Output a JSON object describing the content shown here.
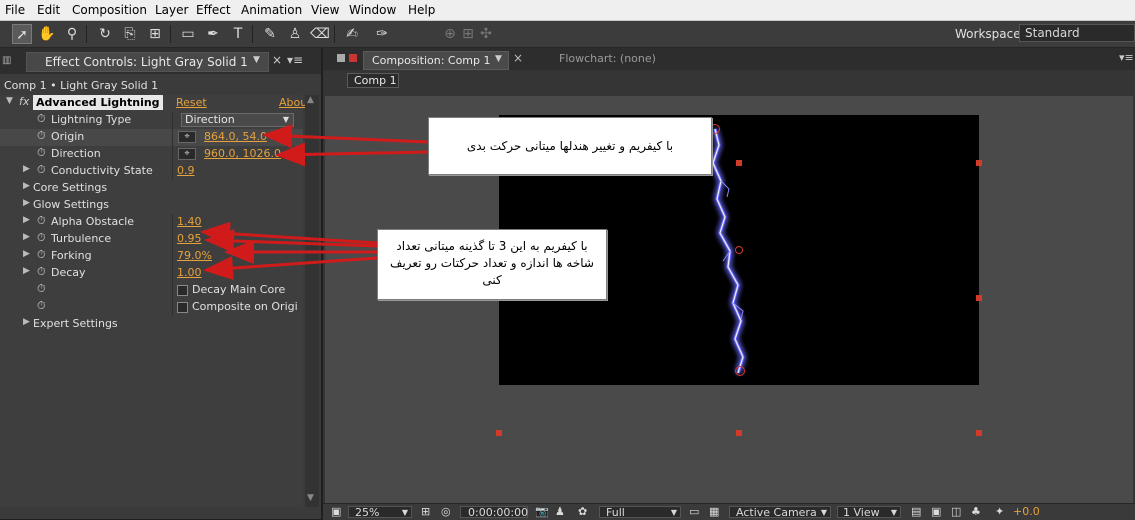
{
  "menu": [
    "File",
    "Edit",
    "Composition",
    "Layer",
    "Effect",
    "Animation",
    "View",
    "Window",
    "Help"
  ],
  "workspace": {
    "label": "Workspace:",
    "value": "Standard"
  },
  "effect_panel": {
    "tab_label": "Effect Controls: Light Gray Solid 1",
    "breadcrumb": "Comp 1 • Light Gray Solid 1",
    "effect_name": "Advanced Lightning",
    "reset": "Reset",
    "about": "Abou",
    "lightning_type": {
      "label": "Lightning Type",
      "value": "Direction"
    },
    "origin": {
      "label": "Origin",
      "value": "864.0, 54.0"
    },
    "direction": {
      "label": "Direction",
      "value": "960.0, 1026.0"
    },
    "conductivity": {
      "label": "Conductivity State",
      "value": "0.9"
    },
    "core_settings": "Core Settings",
    "glow_settings": "Glow Settings",
    "alpha_obstacle": {
      "label": "Alpha Obstacle",
      "value": "1.40"
    },
    "turbulence": {
      "label": "Turbulence",
      "value": "0.95"
    },
    "forking": {
      "label": "Forking",
      "value": "79.0%"
    },
    "decay": {
      "label": "Decay",
      "value": "1.00"
    },
    "decay_main_core": "Decay Main Core",
    "composite_on_original": "Composite on Origi",
    "expert_settings": "Expert Settings"
  },
  "comp_panel": {
    "tab_label": "Composition: Comp 1",
    "flowchart_label": "Flowchart: (none)",
    "comp_button": "Comp 1"
  },
  "viewer_footer": {
    "zoom": "25%",
    "timecode": "0:00:00:00",
    "resolution": "Full",
    "camera": "Active Camera",
    "views": "1 View",
    "exposure": "+0.0"
  },
  "callouts": {
    "top": "با کیفریم و تغییر هندلها میتانی حرکت بدی",
    "bottom": "با کیفریم به این 3 تا گذینه میتانی تعداد شاخه ها اندازه و تعداد حرکتات رو تعریف کنی"
  },
  "colors": {
    "value": "#e6a23c",
    "arrow": "#d11b1b",
    "handle": "#d23a2a",
    "lightning": "#6b6bff"
  }
}
